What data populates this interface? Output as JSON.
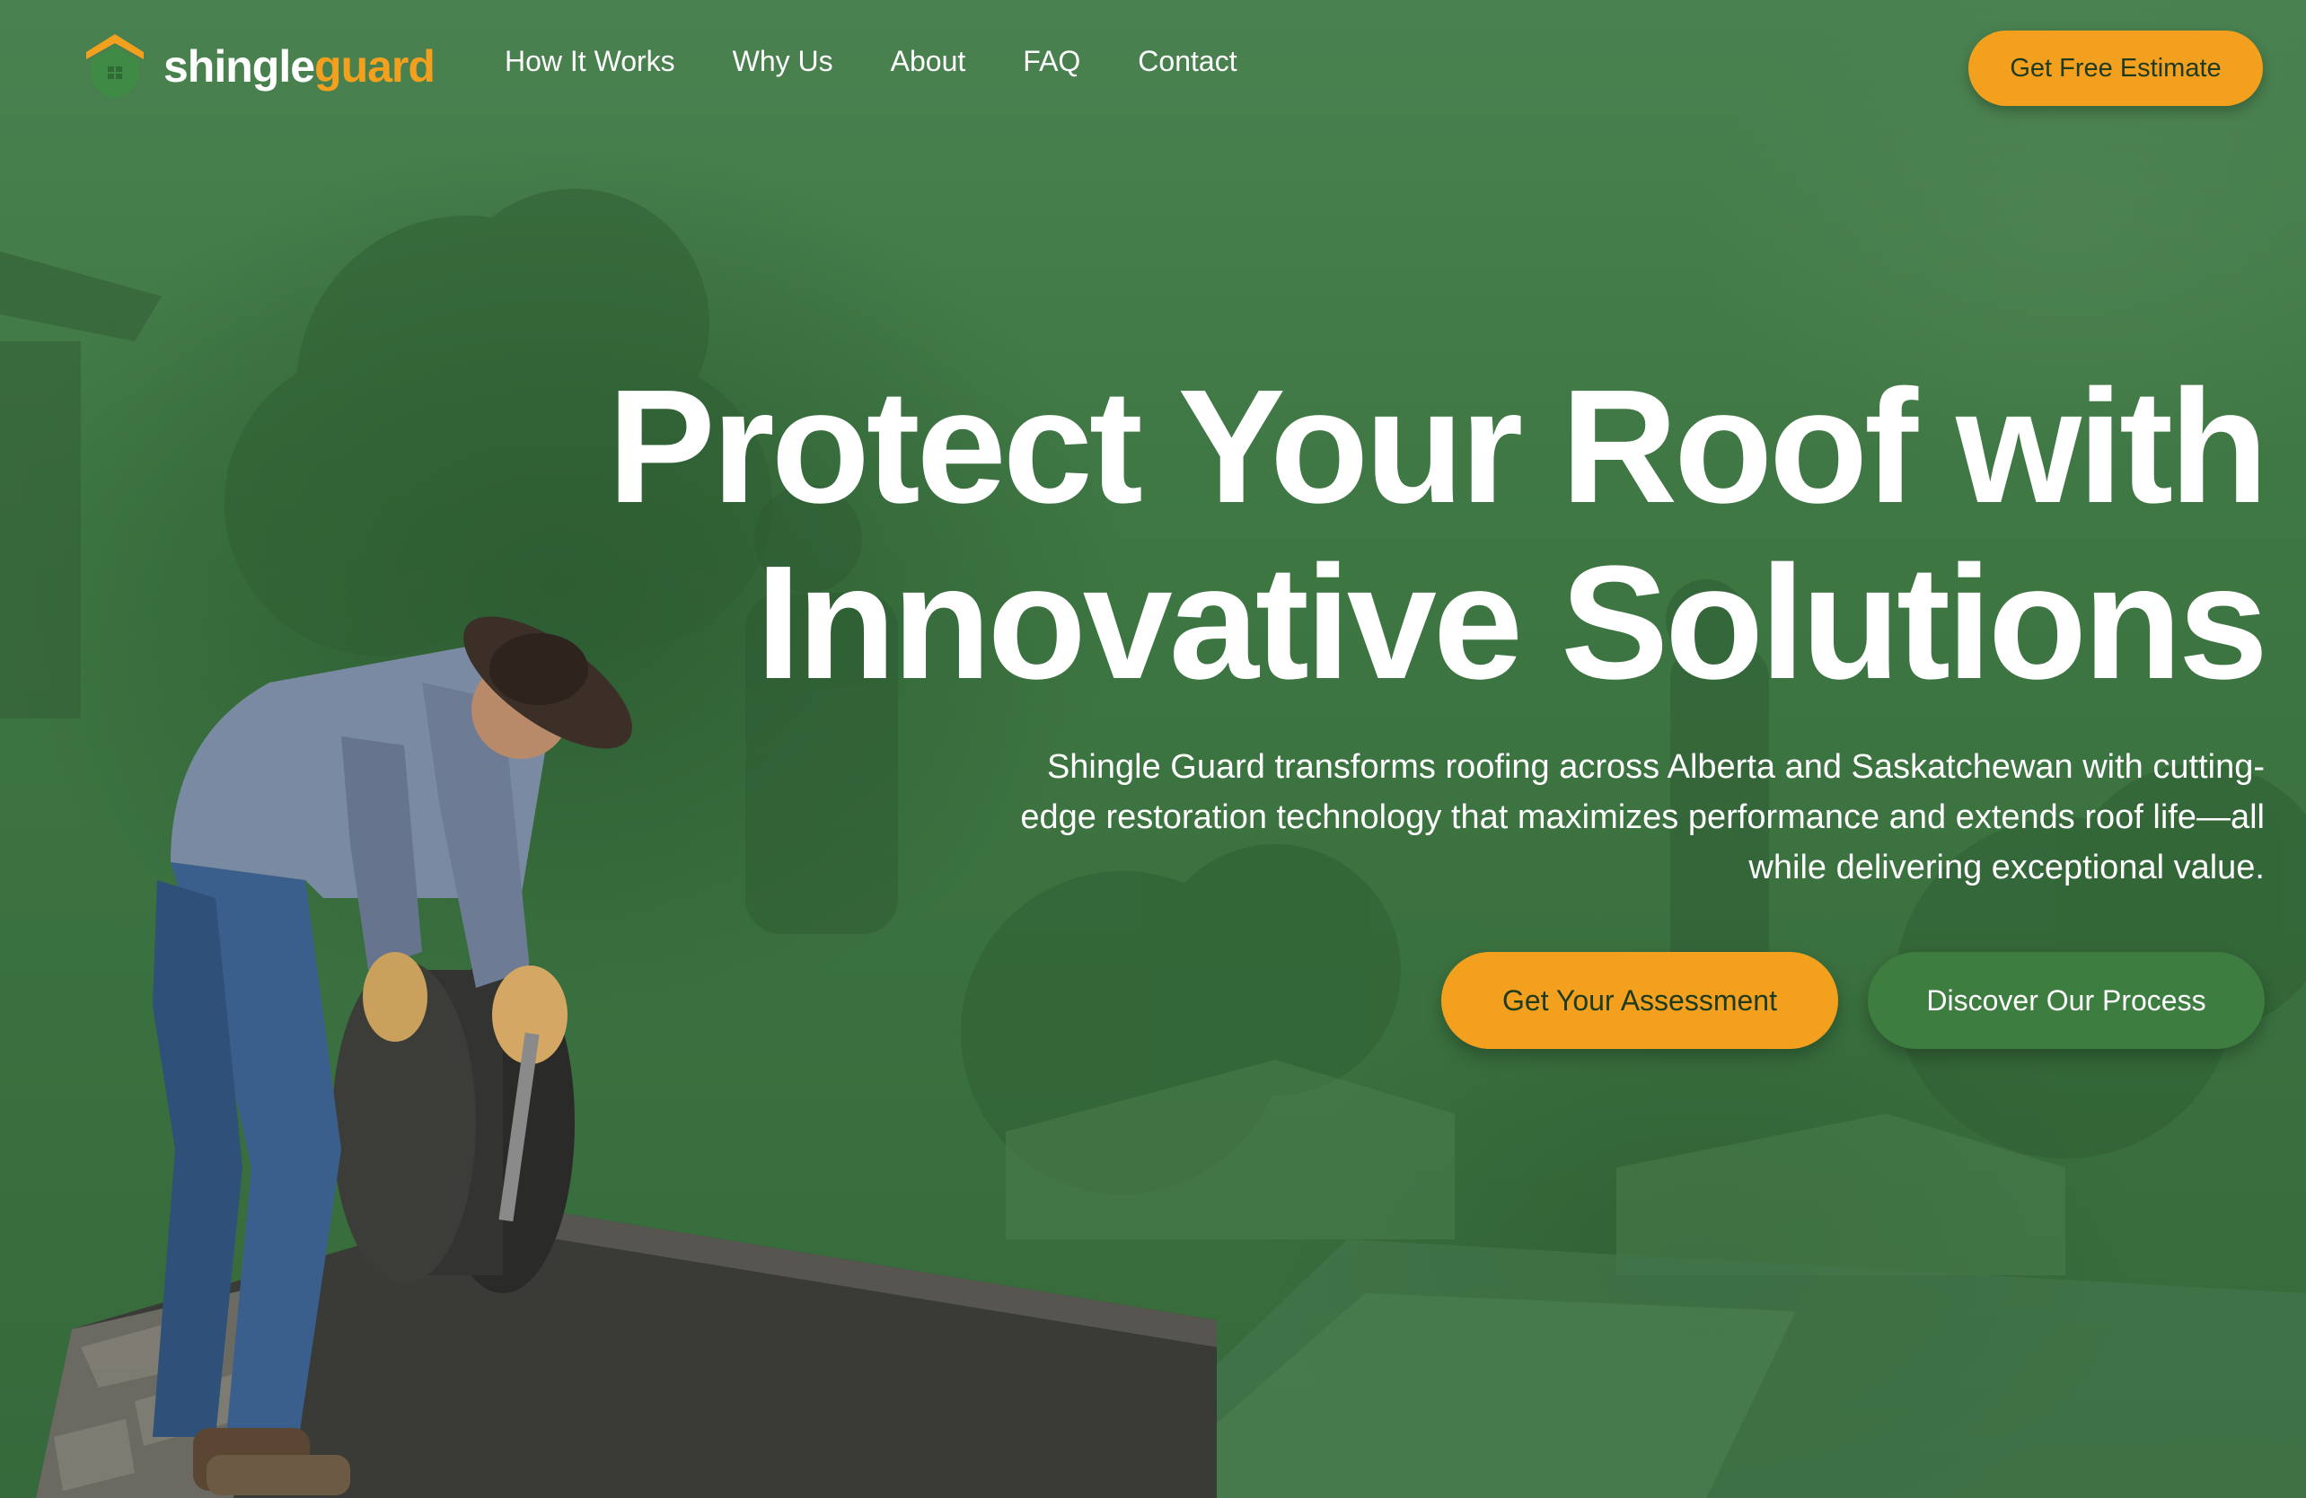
{
  "brand": {
    "name_part1": "shingle",
    "name_part2": "guard",
    "accent_color": "#f2a01e",
    "background_color": "#3c7340"
  },
  "nav": {
    "items": [
      {
        "label": "How It Works"
      },
      {
        "label": "Why Us"
      },
      {
        "label": "About"
      },
      {
        "label": "FAQ"
      },
      {
        "label": "Contact"
      }
    ]
  },
  "header": {
    "cta_label": "Get Free Estimate"
  },
  "hero": {
    "title_line1": "Protect Your Roof with",
    "title_line2": "Innovative Solutions",
    "subtitle": "Shingle Guard transforms roofing across Alberta and Saskatchewan with cutting-edge restoration technology that maximizes performance and extends roof life—all while delivering exceptional value.",
    "primary_cta": "Get Your Assessment",
    "secondary_cta": "Discover Our Process"
  },
  "icons": {
    "logo": "house-shield-icon"
  }
}
